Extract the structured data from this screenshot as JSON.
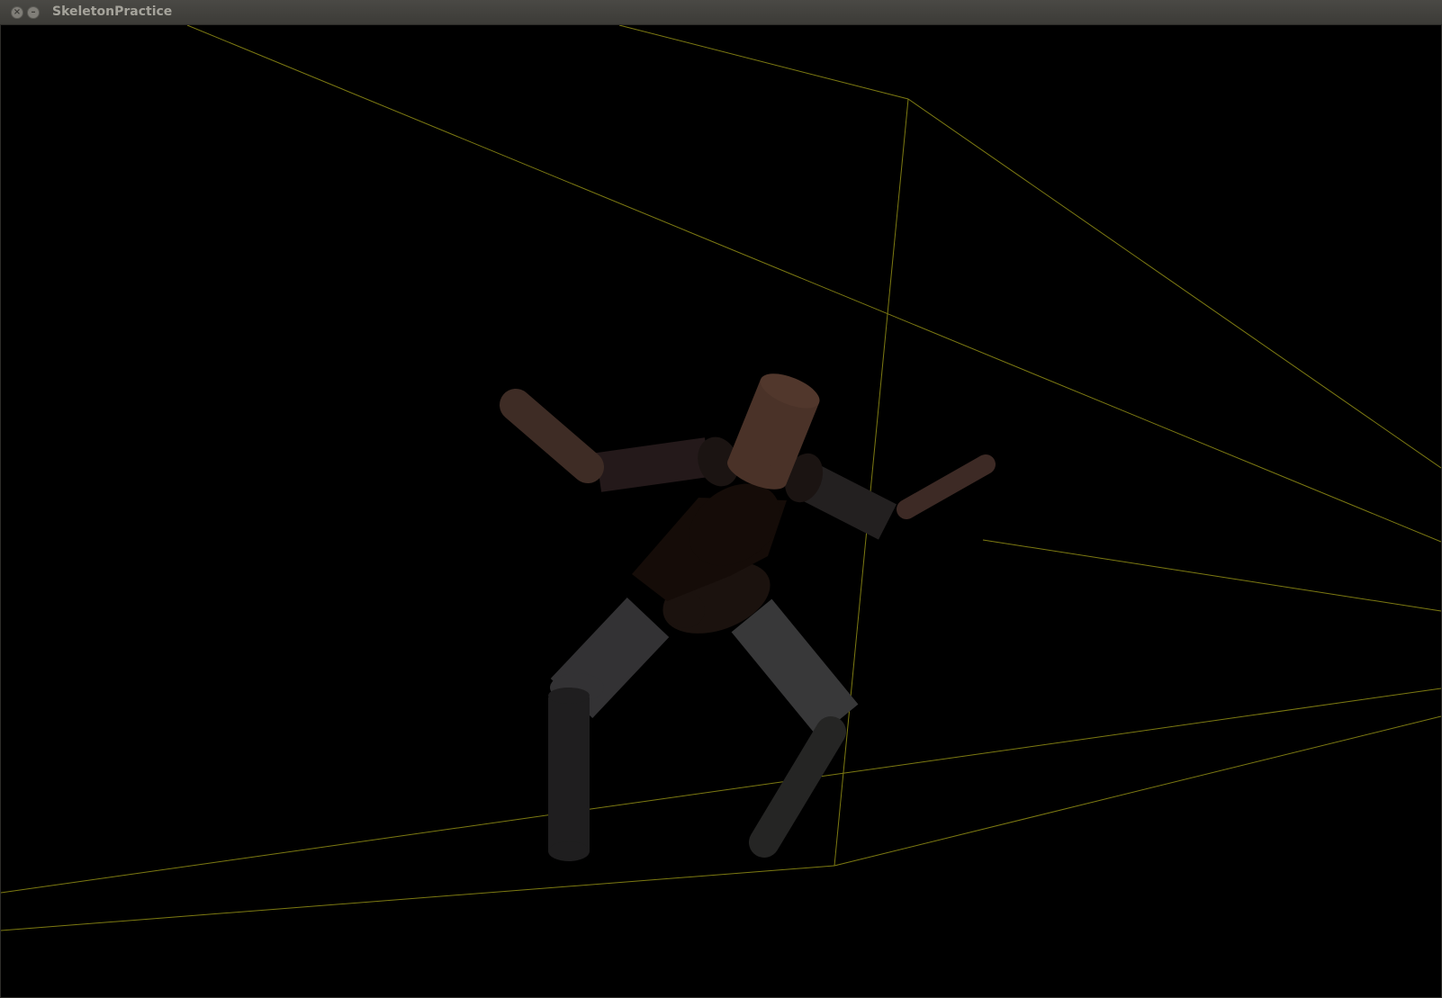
{
  "window": {
    "title": "SkeletonPractice",
    "close_icon": "close-icon",
    "minimize_icon": "minimize-icon"
  },
  "scene": {
    "background_color": "#000000",
    "wire_color": "#7d7a12",
    "colors": {
      "head": "#4a3228",
      "forearm_left": "#3e2c25",
      "forearm_right": "#3d2a25",
      "upper_arm_left": "#24191a",
      "upper_arm_right": "#232020",
      "torso": "#150c08",
      "pelvis": "#1b120e",
      "thigh_left": "#333234",
      "thigh_right": "#383839",
      "shin_left": "#1f1e1f",
      "shin_right": "#252524",
      "joint": "#1b1412"
    }
  }
}
